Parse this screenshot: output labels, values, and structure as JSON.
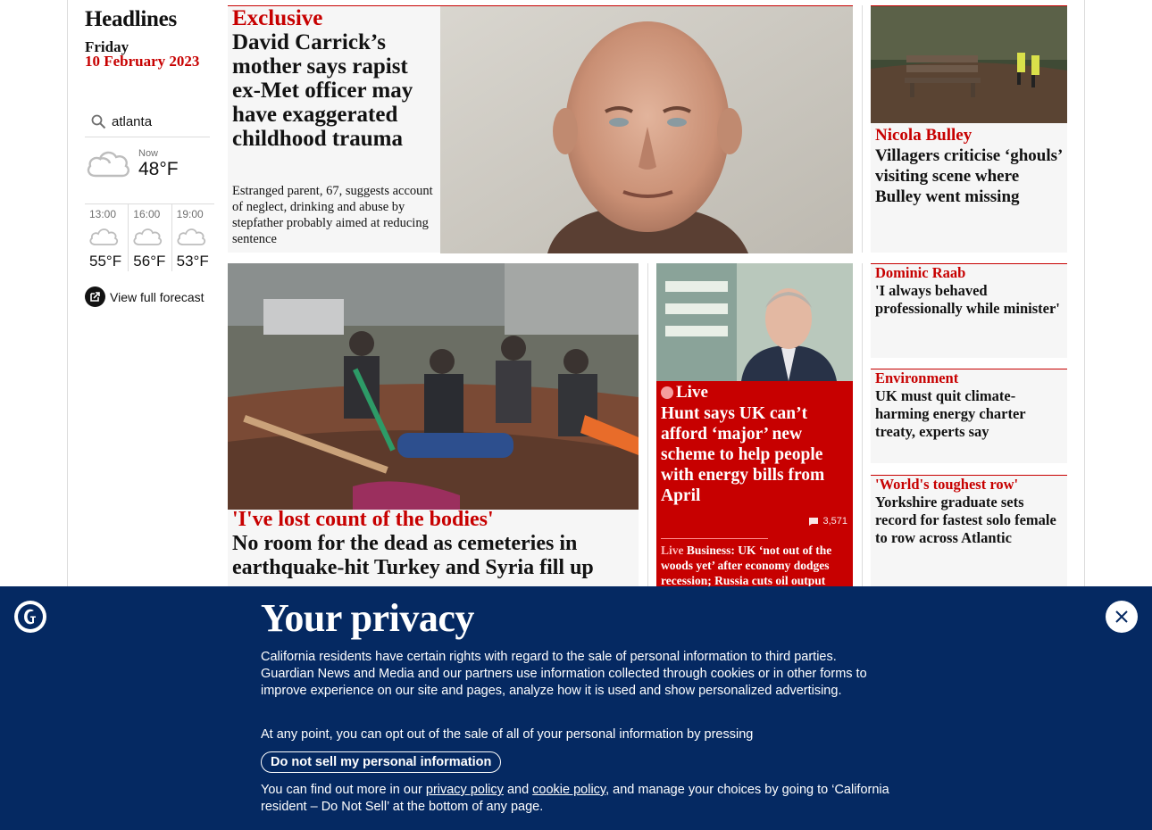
{
  "sidebar": {
    "title": "Headlines",
    "day": "Friday",
    "date": "10 February 2023",
    "weather": {
      "location": "atlanta",
      "now_label": "Now",
      "now_temp": "48°F",
      "forecast": [
        {
          "time": "13:00",
          "temp": "55°F",
          "icon": "cloud-icon"
        },
        {
          "time": "16:00",
          "temp": "56°F",
          "icon": "cloud-icon"
        },
        {
          "time": "19:00",
          "temp": "53°F",
          "icon": "cloud-icon"
        }
      ],
      "full_forecast_label": "View full forecast"
    }
  },
  "lead": {
    "kicker": "Exclusive",
    "headline": "David Carrick’s mother says rapist ex-Met officer may have exaggerated childhood trauma",
    "standfirst": "Estranged parent, 67, suggests account of neglect, drinking and abuse by stepfather probably aimed at reducing sentence"
  },
  "right_top": {
    "kicker": "Nicola Bulley",
    "headline": "Villagers criticise ‘ghouls’ visiting scene where Bulley went missing"
  },
  "quake": {
    "kicker": "'I've lost count of the bodies'",
    "headline": "No room for the dead as cemeteries in earthquake-hit Turkey and Syria fill up"
  },
  "live": {
    "label": "Live",
    "headline": "Hunt says UK can’t afford ‘major’ new scheme to help people with energy bills from April",
    "comments": "3,571",
    "sub_label": "Live",
    "sub_text": "Business: UK ‘not out of the woods yet’ after economy dodges recession; Russia cuts oil output"
  },
  "right_cards": [
    {
      "kicker": "Dominic Raab",
      "headline": "'I always behaved professionally while minister'"
    },
    {
      "kicker": "Environment",
      "headline": "UK must quit climate-harming energy charter treaty, experts say"
    },
    {
      "kicker": "'World's toughest row'",
      "headline": "Yorkshire graduate sets record for fastest solo female to row across Atlantic"
    }
  ],
  "privacy": {
    "title": "Your privacy",
    "p1": "California residents have certain rights with regard to the sale of personal information to third parties. Guardian News and Media and our partners use information collected through cookies or in other forms to improve experience on our site and pages, analyze how it is used and show personalized advertising.",
    "p2": "At any point, you can opt out of the sale of all of your personal information by pressing",
    "button": "Do not sell my personal information",
    "p3_before": "You can find out more in our",
    "privacy_link": "privacy policy",
    "p3_and": "and",
    "cookie_link": "cookie policy",
    "p3_after": ", and manage your choices by going to ‘California resident – Do Not Sell’ at the bottom of any page."
  },
  "colors": {
    "accent": "#c70000",
    "banner": "#052962",
    "card": "#f6f6f6"
  }
}
